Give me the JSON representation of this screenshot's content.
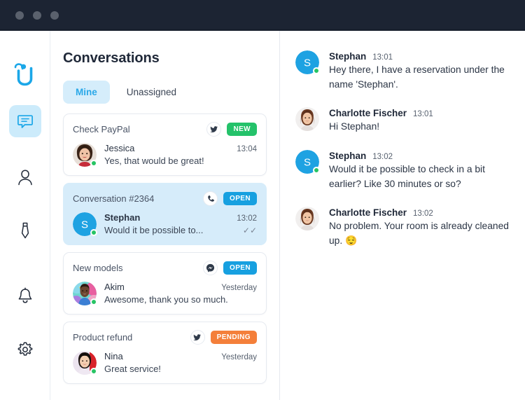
{
  "window": {
    "dots": [
      "close-dot",
      "minimize-dot",
      "maximize-dot"
    ],
    "titlebar_color": "#1c2433"
  },
  "brand": {
    "logo_name": "userlike-logo",
    "color": "#1ba7e8"
  },
  "sidebar": {
    "items": [
      {
        "icon": "chat-bubble-icon",
        "label": "Conversations",
        "active": true
      },
      {
        "icon": "contacts-person-icon",
        "label": "Contacts",
        "active": false
      },
      {
        "icon": "necktie-operator-icon",
        "label": "Operators",
        "active": false
      },
      {
        "icon": "bell-notifications-icon",
        "label": "Notifications",
        "active": false
      },
      {
        "icon": "gear-settings-icon",
        "label": "Settings",
        "active": false
      }
    ]
  },
  "list_pane": {
    "title": "Conversations",
    "tabs": [
      {
        "label": "Mine",
        "active": true
      },
      {
        "label": "Unassigned",
        "active": false
      }
    ],
    "conversations": [
      {
        "subject": "Check PayPal",
        "channel_icon": "twitter-bird-icon",
        "status": "NEW",
        "status_color": "#24c26a",
        "name": "Jessica",
        "time": "13:04",
        "snippet": "Yes, that would be great!",
        "selected": false,
        "online": true,
        "read_ticks": "",
        "avatar": "photo-jessica"
      },
      {
        "subject": "Conversation #2364",
        "channel_icon": "phone-handset-icon",
        "status": "OPEN",
        "status_color": "#17a0e0",
        "name": "Stephan",
        "time": "13:02",
        "snippet": "Would it be possible to...",
        "selected": true,
        "online": true,
        "read_ticks": "✓✓",
        "avatar": "initial-s"
      },
      {
        "subject": "New models",
        "channel_icon": "facebook-messenger-icon",
        "status": "OPEN",
        "status_color": "#17a0e0",
        "name": "Akim",
        "time": "Yesterday",
        "snippet": "Awesome, thank you so much.",
        "selected": false,
        "online": true,
        "read_ticks": "",
        "avatar": "photo-akim"
      },
      {
        "subject": "Product refund",
        "channel_icon": "twitter-bird-icon",
        "status": "PENDING",
        "status_color": "#f47f3a",
        "name": "Nina",
        "time": "Yesterday",
        "snippet": "Great service!",
        "selected": false,
        "online": true,
        "read_ticks": "",
        "avatar": "photo-nina"
      }
    ]
  },
  "chat_pane": {
    "messages": [
      {
        "author": "Stephan",
        "time": "13:01",
        "text": "Hey there, I have a reservation under the name 'Stephan'.",
        "avatar": "initial-s",
        "online": true
      },
      {
        "author": "Charlotte Fischer",
        "time": "13:01",
        "text": "Hi Stephan!",
        "avatar": "photo-charlotte",
        "online": false
      },
      {
        "author": "Stephan",
        "time": "13:02",
        "text": "Would it be possible to check in a bit earlier? Like 30 minutes or so?",
        "avatar": "initial-s",
        "online": true
      },
      {
        "author": "Charlotte Fischer",
        "time": "13:02",
        "text": "No problem. Your room is already cleaned up. 😌",
        "avatar": "photo-charlotte",
        "online": false
      }
    ]
  }
}
